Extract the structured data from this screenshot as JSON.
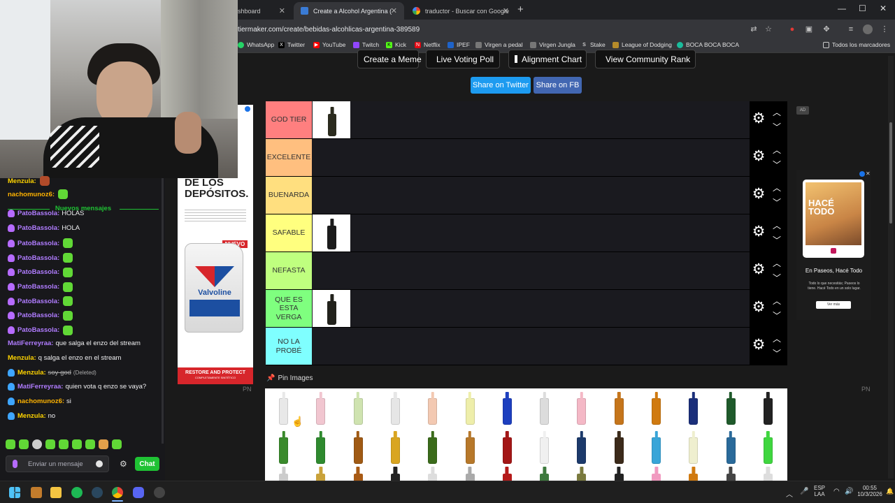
{
  "tabs": [
    {
      "label": "shboard",
      "close": "✕"
    },
    {
      "label": "Create a Alcohol Argentina (Es",
      "close": "✕"
    },
    {
      "label": "traductor - Buscar con Google",
      "close": "✕"
    }
  ],
  "new_tab": "+",
  "url": "tiermaker.com/create/bebidas-alcohlicas-argentina-389589",
  "bookmarks": [
    "WhatsApp",
    "Twitter",
    "YouTube",
    "Twitch",
    "Kick",
    "Netflix",
    "IPEF",
    "Virgen a pedal",
    "Virgen Jungla",
    "Stake",
    "League of Dodging",
    "BOCA BOCA BOCA"
  ],
  "bookmarks_folder": "Todos los marcadores",
  "toolbar": {
    "create_meme": "Create a Meme",
    "live_poll": "Live Voting Poll",
    "alignment": "Alignment Chart",
    "community": "View Community Rank",
    "share_twitter": "Share on Twitter",
    "share_fb": "Share on FB"
  },
  "tiers": [
    {
      "label": "GOD TIER",
      "color": "#ff7f7f",
      "items": 1
    },
    {
      "label": "EXCELENTE",
      "color": "#ffbf7f",
      "items": 0
    },
    {
      "label": "BUENARDA",
      "color": "#ffdf7f",
      "items": 0
    },
    {
      "label": "SAFABLE",
      "color": "#ffff7f",
      "items": 1
    },
    {
      "label": "NEFASTA",
      "color": "#bfff7f",
      "items": 0
    },
    {
      "label": "QUE ES ESTA VERGA",
      "color": "#7fff7f",
      "items": 1
    },
    {
      "label": "NO LA PROBÉ",
      "color": "#7fffff",
      "items": 0
    }
  ],
  "pin_images": "Pin Images",
  "ad_tag": "AD",
  "pn_left": "PN",
  "pn_right": "PN",
  "left_ad": {
    "headline": "DE LOS DEPÓSITOS.",
    "badge": "NUEVO",
    "brand": "Valvoline",
    "footer": "RESTORE AND PROTECT",
    "footer_sub": "COMPLETAMENTE SINTÉTICO"
  },
  "right_ad": {
    "title": "HACÉ TODO",
    "headline": "En Paseos, Hacé Todo",
    "body": "Todo lo que necesitás; Paseos lo tiene. Hacé Todo en un solo lugar.",
    "button": "Ver más"
  },
  "chat": {
    "top_user": "Menzula:",
    "messages": [
      {
        "user": "nachomunoz6:",
        "color": "#ffb300",
        "text": "",
        "emote": true
      },
      {
        "user": "PatoBassola:",
        "color": "#b07cff",
        "text": "HOLAS",
        "emote": false,
        "badge": "#b66bff"
      },
      {
        "user": "PatoBassola:",
        "color": "#b07cff",
        "text": "HOLA",
        "emote": false,
        "badge": "#b66bff"
      },
      {
        "user": "PatoBassola:",
        "color": "#b07cff",
        "text": "",
        "emote": true,
        "badge": "#b66bff"
      },
      {
        "user": "PatoBassola:",
        "color": "#b07cff",
        "text": "",
        "emote": true,
        "badge": "#b66bff"
      },
      {
        "user": "PatoBassola:",
        "color": "#b07cff",
        "text": "",
        "emote": true,
        "badge": "#b66bff"
      },
      {
        "user": "PatoBassola:",
        "color": "#b07cff",
        "text": "",
        "emote": true,
        "badge": "#b66bff"
      },
      {
        "user": "PatoBassola:",
        "color": "#b07cff",
        "text": "",
        "emote": true,
        "badge": "#b66bff"
      },
      {
        "user": "PatoBassola:",
        "color": "#b07cff",
        "text": "",
        "emote": true,
        "badge": "#b66bff"
      },
      {
        "user": "PatoBassola:",
        "color": "#b07cff",
        "text": "",
        "emote": true,
        "badge": "#b66bff"
      },
      {
        "user": "MatiFerreyraa:",
        "color": "#b07cff",
        "text": "que salga el enzo del stream",
        "emote": false
      },
      {
        "user": "Menzula:",
        "color": "#ffd400",
        "text": "q salga el enzo en el stream",
        "emote": false
      },
      {
        "user": "Menzula:",
        "color": "#ffd400",
        "text": "soy god",
        "deleted": "(Deleted)",
        "emote": false,
        "badge": "#3ea6ff"
      },
      {
        "user": "MatiFerreyraa:",
        "color": "#b07cff",
        "text": "quien vota q enzo se vaya?",
        "emote": false,
        "badge": "#3ea6ff"
      },
      {
        "user": "nachomunoz6:",
        "color": "#ffb300",
        "text": "si",
        "emote": false,
        "badge": "#3ea6ff"
      },
      {
        "user": "Menzula:",
        "color": "#ffd400",
        "text": "no",
        "emote": false,
        "badge": "#3ea6ff"
      }
    ],
    "new_messages": "Nuevos mensajes",
    "input_placeholder": "Enviar un mensaje",
    "send_button": "Chat"
  },
  "tray": {
    "lang1": "ESP",
    "lang2": "LAA",
    "time": "00:55",
    "date": "10/3/2026"
  }
}
